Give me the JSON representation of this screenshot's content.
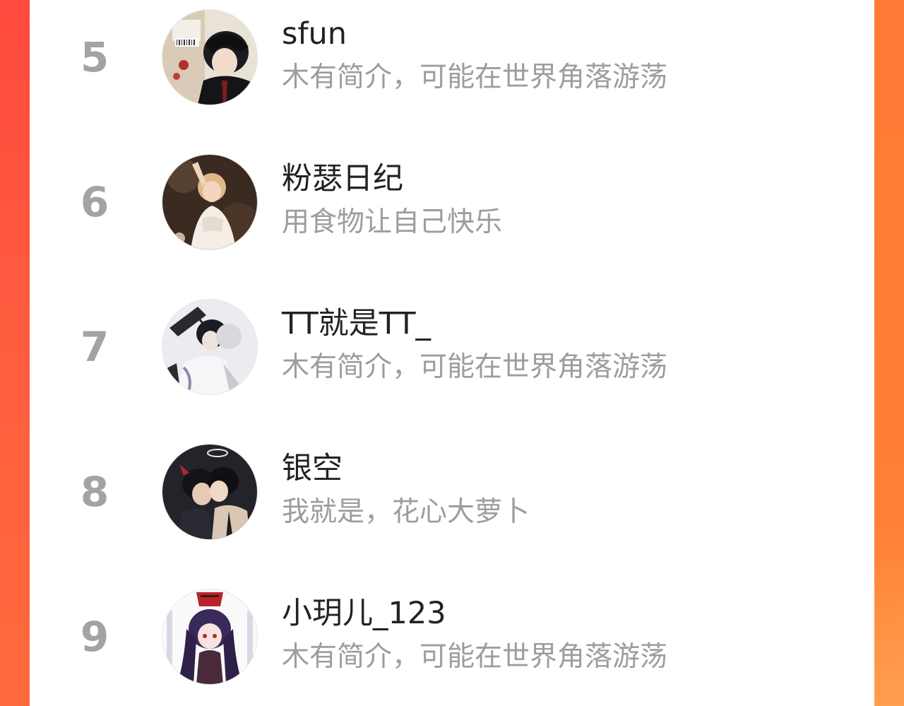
{
  "colors": {
    "background_left": "#ff4a3d",
    "background_right": "#ff7f34",
    "panel": "#ffffff",
    "rank_text": "#a3a3a3",
    "name_text": "#222222",
    "bio_text": "#9d9d9d"
  },
  "ranking": {
    "items": [
      {
        "rank": "5",
        "name": "sfun",
        "bio": "木有简介，可能在世界角落游荡",
        "avatar_icon": "anime-avatar-icon"
      },
      {
        "rank": "6",
        "name": "粉瑟日纪",
        "bio": "用食物让自己快乐",
        "avatar_icon": "painting-avatar-icon"
      },
      {
        "rank": "7",
        "name": "TT就是TT_",
        "bio": "木有简介，可能在世界角落游荡",
        "avatar_icon": "anime-avatar-icon"
      },
      {
        "rank": "8",
        "name": "银空",
        "bio": "我就是，花心大萝卜",
        "avatar_icon": "anime-avatar-icon"
      },
      {
        "rank": "9",
        "name": "小玥儿_123",
        "bio": "木有简介，可能在世界角落游荡",
        "avatar_icon": "anime-avatar-icon"
      }
    ]
  }
}
